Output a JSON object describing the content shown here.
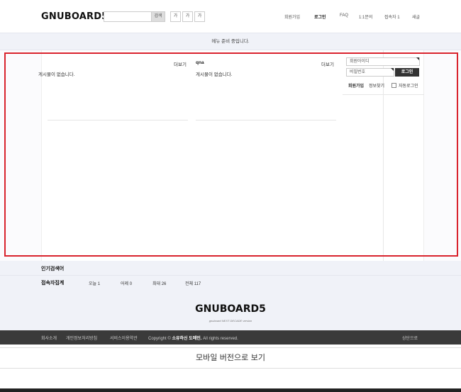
{
  "header": {
    "logo": "GNUBOARD5",
    "search_button": "검색",
    "font_buttons": [
      "가",
      "가",
      "가"
    ],
    "nav": [
      {
        "label": "회원가입",
        "bold": false
      },
      {
        "label": "로그인",
        "bold": true
      },
      {
        "label": "FAQ",
        "bold": false
      },
      {
        "label": "1:1문의",
        "bold": false
      },
      {
        "label": "접속자 1",
        "bold": false
      },
      {
        "label": "새글",
        "bold": false
      }
    ]
  },
  "notice": "메뉴 준비 중입니다.",
  "latest": [
    {
      "title": "",
      "more": "더보기",
      "empty": "게시물이 없습니다."
    },
    {
      "title": "qna",
      "more": "더보기",
      "empty": "게시물이 없습니다."
    }
  ],
  "outlogin": {
    "id_placeholder": "회원아이디",
    "pw_placeholder": "비밀번호",
    "login_button": "로그인",
    "join": "회원가입",
    "find": "정보찾기",
    "auto_login": "자동로그인"
  },
  "popular": {
    "title": "인기검색어"
  },
  "visit": {
    "title": "접속자집계",
    "items": [
      "오늘 1",
      "어제 0",
      "최대 26",
      "전체 117"
    ]
  },
  "footer": {
    "logo": "GNUBOARD5",
    "tagline": "gnuboard NEXT DECADE version",
    "links": [
      "회사소개",
      "개인정보처리방침",
      "서비스이용약관"
    ],
    "copyright_prefix": "Copyright ©",
    "copyright_domain": "소유하신 도메인.",
    "copyright_suffix": "All rights reserved.",
    "top": "상단으로"
  },
  "mobile_version": "모바일 버전으로 보기",
  "colors": {
    "highlight": "#d9232d",
    "footer_bar": "#3a3a3a",
    "band": "#f0f2f8"
  }
}
